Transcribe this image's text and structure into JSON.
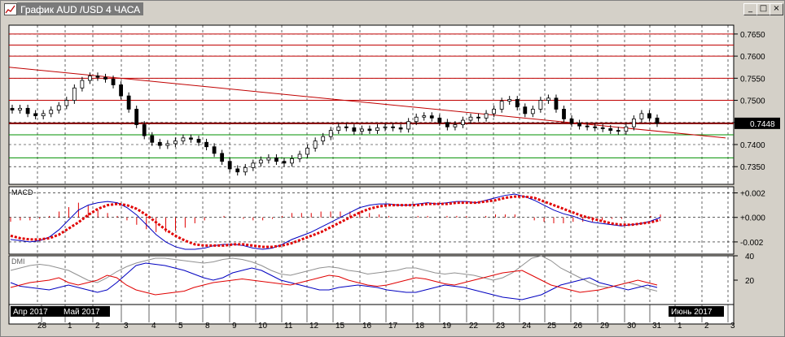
{
  "window": {
    "title": "График AUD /USD  4 ЧАСА",
    "minimize_label": "_",
    "maximize_label": "□",
    "close_label": "×"
  },
  "chart_data": [
    {
      "type": "candlestick",
      "panel": "price",
      "symbol": "AUD/USD",
      "timeframe": "4 ЧАСА",
      "ylim": [
        0.731,
        0.767
      ],
      "yticks": [
        "0.7650",
        "0.7600",
        "0.7550",
        "0.7500",
        "0.7450",
        "0.7400",
        "0.7350"
      ],
      "current_price_label": "0.7448",
      "current_price": 0.7448,
      "horizontal_levels_red": [
        0.765,
        0.7625,
        0.76,
        0.755,
        0.75
      ],
      "horizontal_level_dark": 0.7448,
      "horizontal_levels_green": [
        0.7422,
        0.737
      ],
      "trendline": {
        "from_price": 0.7575,
        "to_price": 0.7415
      },
      "close_series": [
        0.7478,
        0.7482,
        0.747,
        0.7465,
        0.747,
        0.7478,
        0.7488,
        0.75,
        0.7528,
        0.7545,
        0.7555,
        0.7552,
        0.7548,
        0.7535,
        0.751,
        0.748,
        0.7445,
        0.742,
        0.7405,
        0.7398,
        0.7402,
        0.7408,
        0.7415,
        0.7412,
        0.7405,
        0.7395,
        0.738,
        0.7362,
        0.7345,
        0.7338,
        0.7348,
        0.7358,
        0.7365,
        0.737,
        0.7362,
        0.7358,
        0.7368,
        0.7378,
        0.7392,
        0.7408,
        0.7418,
        0.7432,
        0.744,
        0.7438,
        0.743,
        0.7435,
        0.7432,
        0.7438,
        0.744,
        0.7438,
        0.7435,
        0.7452,
        0.7462,
        0.7465,
        0.746,
        0.745,
        0.744,
        0.7445,
        0.7455,
        0.7462,
        0.746,
        0.747,
        0.748,
        0.7498,
        0.7502,
        0.7485,
        0.747,
        0.748,
        0.75,
        0.7505,
        0.748,
        0.7458,
        0.7448,
        0.7442,
        0.744,
        0.7438,
        0.7436,
        0.7432,
        0.743,
        0.744,
        0.7458,
        0.747,
        0.746,
        0.7448
      ]
    },
    {
      "type": "line",
      "panel": "MACD",
      "label": "MACD",
      "ylim": [
        -0.003,
        0.0025
      ],
      "yticks": [
        "+0.002",
        "+0.000",
        "-0.002"
      ],
      "macd_line": [
        -0.0018,
        -0.0019,
        -0.002,
        -0.0019,
        -0.0016,
        -0.001,
        -0.0002,
        0.0006,
        0.001,
        0.0012,
        0.0013,
        0.0012,
        0.0008,
        0.0002,
        -0.0006,
        -0.0014,
        -0.002,
        -0.0024,
        -0.0026,
        -0.0026,
        -0.0025,
        -0.0023,
        -0.0022,
        -0.0022,
        -0.0023,
        -0.0025,
        -0.0026,
        -0.0025,
        -0.0022,
        -0.0018,
        -0.0015,
        -0.0012,
        -0.0008,
        -0.0004,
        0.0,
        0.0004,
        0.0008,
        0.001,
        0.0011,
        0.0011,
        0.001,
        0.001,
        0.0011,
        0.0012,
        0.0011,
        0.0012,
        0.0013,
        0.0013,
        0.0012,
        0.0014,
        0.0016,
        0.0018,
        0.0019,
        0.0017,
        0.0014,
        0.001,
        0.0006,
        0.0003,
        0.0001,
        -0.0002,
        -0.0004,
        -0.0005,
        -0.0006,
        -0.0007,
        -0.0006,
        -0.0005,
        -0.0003,
        0.0
      ],
      "signal_line": [
        -0.0015,
        -0.0017,
        -0.0018,
        -0.0018,
        -0.0017,
        -0.0014,
        -0.0009,
        -0.0004,
        0.0002,
        0.0007,
        0.001,
        0.0011,
        0.001,
        0.0007,
        0.0002,
        -0.0004,
        -0.001,
        -0.0015,
        -0.0019,
        -0.0022,
        -0.0023,
        -0.0023,
        -0.0023,
        -0.0022,
        -0.0022,
        -0.0023,
        -0.0024,
        -0.0024,
        -0.0023,
        -0.0021,
        -0.0018,
        -0.0015,
        -0.0012,
        -0.0008,
        -0.0004,
        0.0,
        0.0004,
        0.0007,
        0.0009,
        0.001,
        0.001,
        0.001,
        0.001,
        0.0011,
        0.0011,
        0.0011,
        0.0012,
        0.0012,
        0.0012,
        0.0013,
        0.0014,
        0.0016,
        0.0017,
        0.0017,
        0.0016,
        0.0013,
        0.001,
        0.0007,
        0.0004,
        0.0001,
        -0.0001,
        -0.0003,
        -0.0005,
        -0.0006,
        -0.0006,
        -0.0005,
        -0.0004,
        -0.0002
      ],
      "colors": {
        "macd": "#0000c0",
        "signal": "#e00000",
        "histogram": "#e00000"
      }
    },
    {
      "type": "line",
      "panel": "DMI",
      "label": "DMI",
      "ylim": [
        0,
        40
      ],
      "yticks": [
        "40",
        "20"
      ],
      "adx": [
        28,
        30,
        32,
        33,
        32,
        30,
        28,
        24,
        20,
        18,
        22,
        27,
        31,
        34,
        36,
        38,
        38,
        37,
        36,
        35,
        34,
        35,
        37,
        38,
        37,
        35,
        32,
        28,
        25,
        24,
        26,
        28,
        30,
        31,
        30,
        28,
        27,
        25,
        26,
        27,
        28,
        30,
        30,
        28,
        26,
        25,
        26,
        25,
        24,
        22,
        20,
        22,
        26,
        32,
        38,
        40,
        36,
        30,
        26,
        22,
        18,
        15,
        14,
        16,
        18,
        16,
        13,
        11
      ],
      "plus_di": [
        18,
        15,
        14,
        13,
        12,
        14,
        16,
        14,
        12,
        10,
        12,
        18,
        25,
        32,
        34,
        33,
        32,
        30,
        28,
        25,
        22,
        20,
        22,
        26,
        28,
        30,
        28,
        24,
        20,
        18,
        16,
        14,
        12,
        12,
        14,
        15,
        16,
        15,
        14,
        12,
        11,
        10,
        10,
        12,
        14,
        16,
        15,
        14,
        12,
        10,
        8,
        6,
        5,
        4,
        6,
        8,
        12,
        16,
        18,
        20,
        22,
        18,
        16,
        14,
        12,
        14,
        16,
        14
      ],
      "minus_di": [
        14,
        16,
        18,
        19,
        20,
        22,
        18,
        16,
        18,
        20,
        24,
        22,
        16,
        12,
        10,
        8,
        9,
        10,
        11,
        14,
        16,
        18,
        19,
        20,
        21,
        20,
        19,
        18,
        17,
        16,
        18,
        20,
        22,
        24,
        23,
        20,
        18,
        16,
        15,
        16,
        18,
        20,
        22,
        21,
        19,
        17,
        16,
        18,
        20,
        22,
        24,
        26,
        27,
        28,
        24,
        20,
        16,
        14,
        12,
        10,
        11,
        12,
        14,
        16,
        18,
        20,
        18,
        16
      ],
      "colors": {
        "adx": "#909090",
        "plus_di": "#0000c0",
        "minus_di": "#e00000"
      }
    }
  ],
  "time_axis": {
    "labels": [
      "28",
      "1",
      "2",
      "3",
      "4",
      "5",
      "8",
      "9",
      "10",
      "11",
      "12",
      "15",
      "16",
      "17",
      "18",
      "19",
      "22",
      "23",
      "24",
      "25",
      "26",
      "29",
      "30",
      "31",
      "1",
      "2",
      "3"
    ],
    "month_labels": {
      "left_1": "Апр 2017",
      "left_2": "Май 2017",
      "right": "Июнь 2017"
    }
  }
}
